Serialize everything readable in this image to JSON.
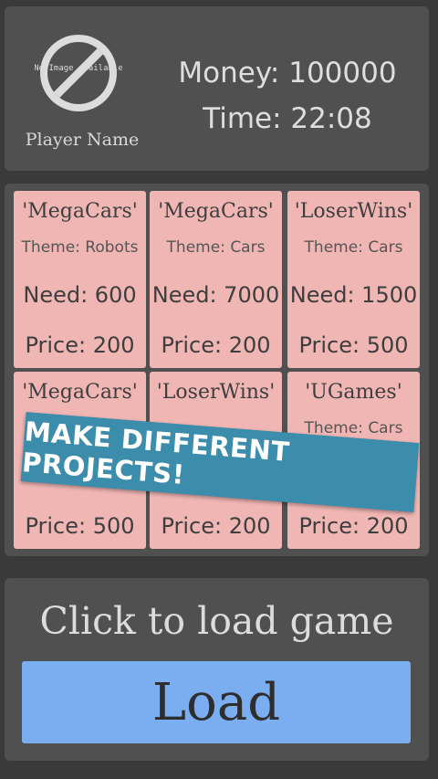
{
  "player": {
    "avatar_text": "No Image available",
    "name": "Player Name"
  },
  "stats": {
    "money": "Money: 100000",
    "time": "Time: 22:08"
  },
  "projects": [
    {
      "title": "'MegaCars'",
      "theme": "Theme: Robots",
      "need": "Need: 600",
      "price": "Price: 200"
    },
    {
      "title": "'MegaCars'",
      "theme": "Theme: Cars",
      "need": "Need: 7000",
      "price": "Price: 200"
    },
    {
      "title": "'LoserWins'",
      "theme": "Theme: Cars",
      "need": "Need: 1500",
      "price": "Price: 500"
    },
    {
      "title": "'MegaCars'",
      "theme": "",
      "need": "",
      "price": "Price: 500"
    },
    {
      "title": "'LoserWins'",
      "theme": "",
      "need": "",
      "price": "Price: 200"
    },
    {
      "title": "'UGames'",
      "theme": "Theme: Cars",
      "need": "",
      "price": "Price: 200"
    }
  ],
  "banner": "MAKE DIFFERENT PROJECTS!",
  "load": {
    "caption": "Click to load game",
    "button_label": "Load"
  }
}
